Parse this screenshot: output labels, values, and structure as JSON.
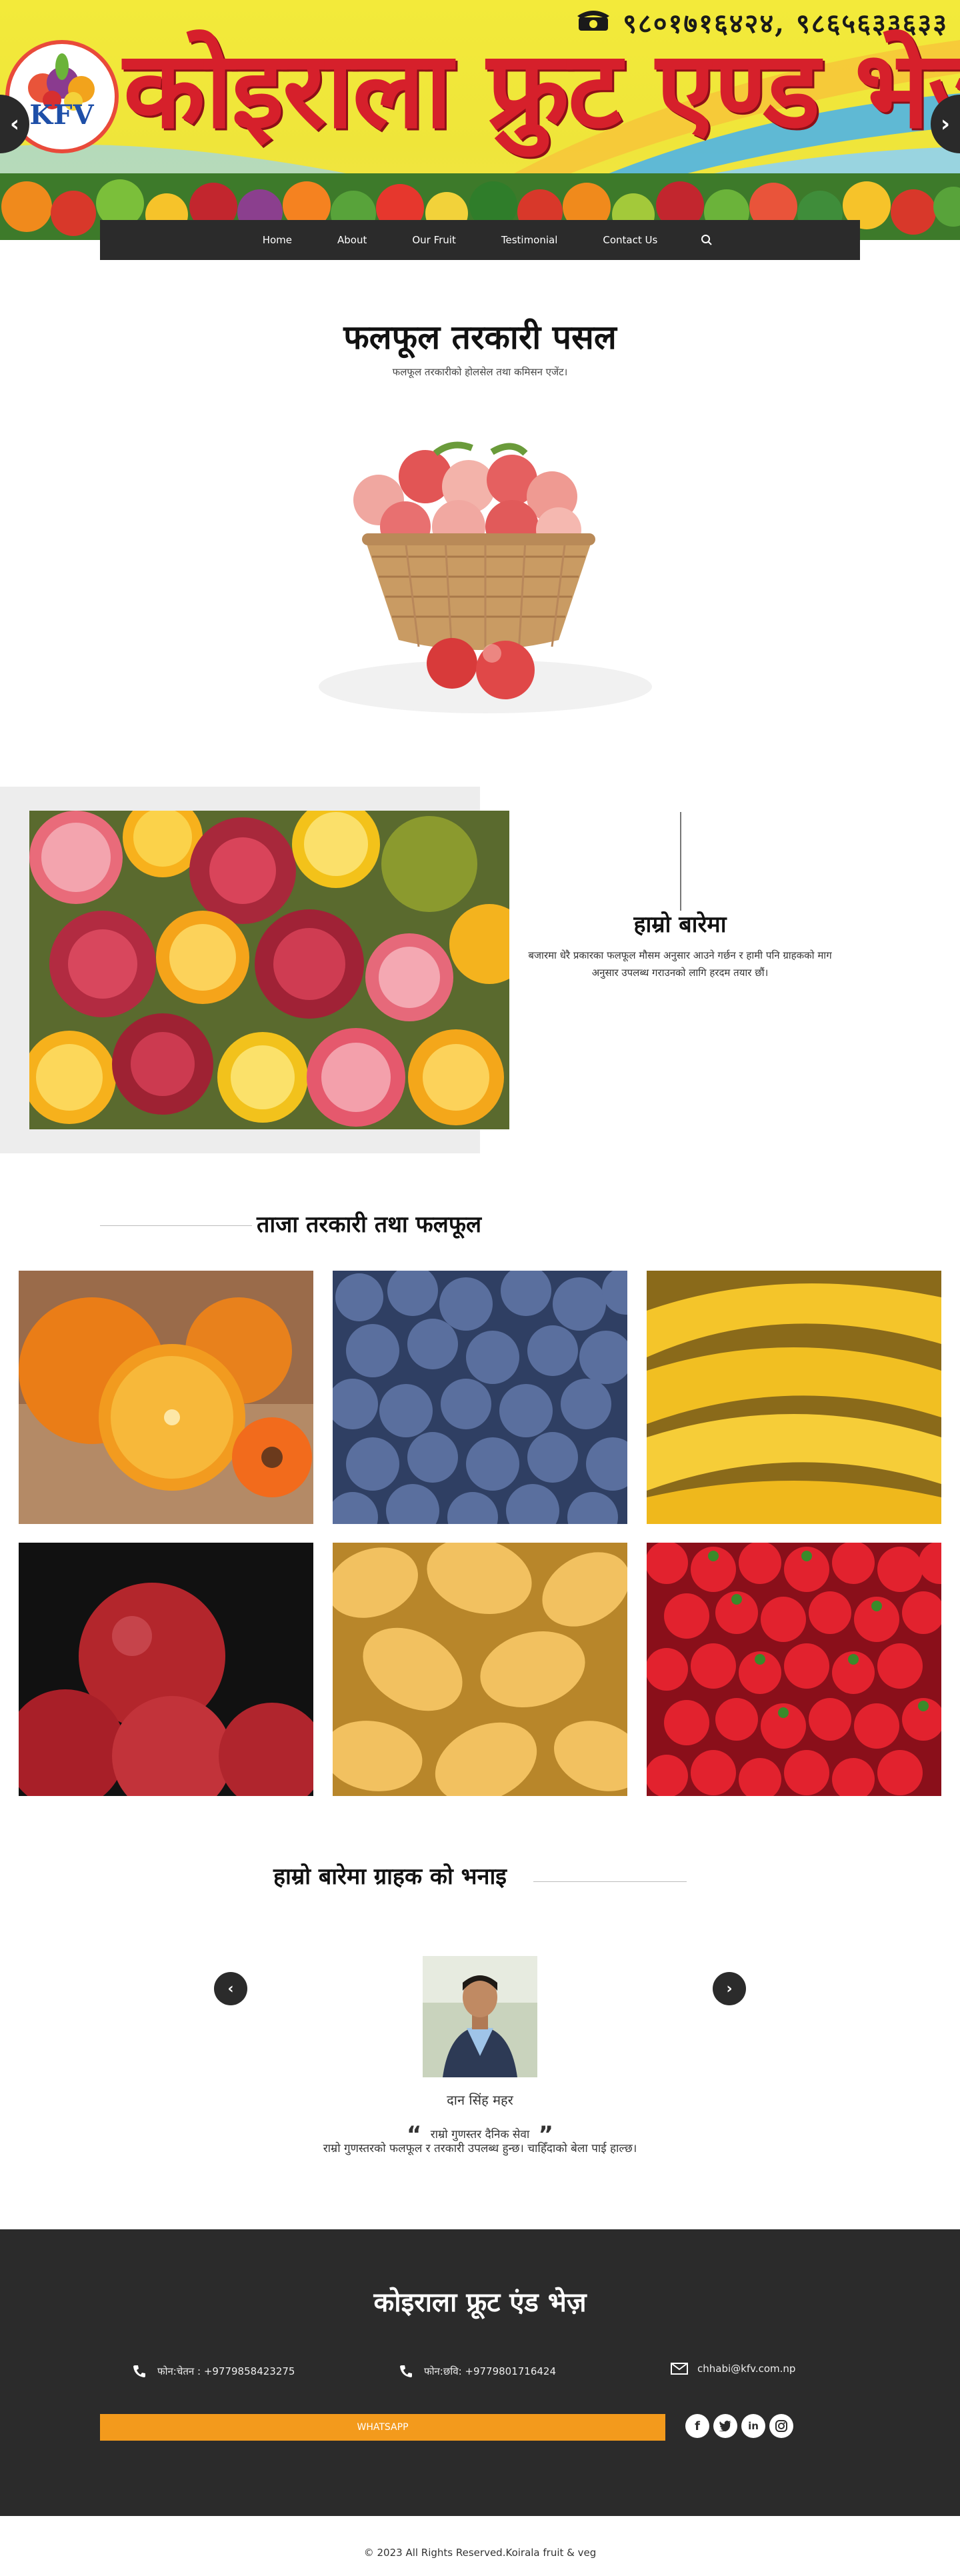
{
  "header": {
    "phone_numbers": "९८०१७१६४२४, ९८६५६३३६३३",
    "banner_title": "कोइराला फ्रुट एण्ड भेज",
    "logo_text": "KFV"
  },
  "nav": {
    "items": [
      "Home",
      "About",
      "Our Fruit",
      "Testimonial",
      "Contact Us"
    ]
  },
  "intro": {
    "title": "फलफूल तरकारी पसल",
    "subtitle": "फलफूल तरकारीको होलसेल तथा कमिसन एजेंट।"
  },
  "about": {
    "title": "हाम्रो बारेमा",
    "text": "बजारमा धेरै प्रकारका फलफूल मौसम अनुसार आउने गर्छन र हामी पनि ग्राहकको माग अनुसार उपलब्ध गराउनको लागि हरदम तयार छौं।"
  },
  "fresh": {
    "title": "ताजा तरकारी तथा फलफूल",
    "tiles": [
      "orange",
      "blueberry",
      "banana",
      "apple",
      "mango",
      "strawberry"
    ]
  },
  "testimonials": {
    "title": "हाम्रो बारेमा ग्राहक को भनाइ",
    "name": "दान सिंह महर",
    "quote": "राम्रो गुणस्तर दैनिक सेवा",
    "text": "राम्रो गुणस्तरको फलफूल र तरकारी उपलब्ध हुन्छ। चाहिँदाको बेला पाई हाल्छ।"
  },
  "footer": {
    "title": "कोइराला फ्रूट एंड भेज़",
    "phone1": "फोन:चेतन : +9779858423275",
    "phone2": "फोन:छवि: +9779801716424",
    "email": "chhabi@kfv.com.np",
    "whatsapp": "WHATSAPP",
    "copyright": "© 2023 All Rights Reserved.Koirala fruit & veg"
  },
  "colors": {
    "banner_yellow": "#f3ea3a",
    "banner_red": "#d6202b",
    "dark": "#2b2b2b",
    "whatsapp_orange": "#f39a1c"
  }
}
